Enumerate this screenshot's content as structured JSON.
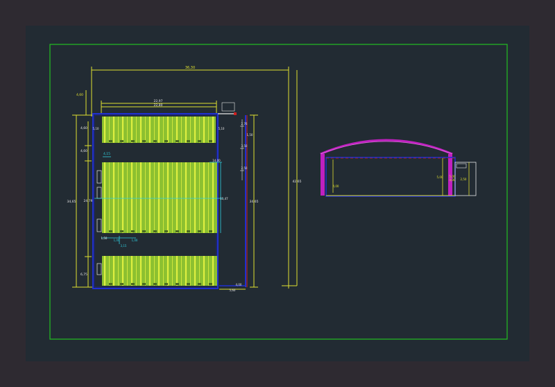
{
  "colors": {
    "window_bg": "#2e2a31",
    "model_bg": "#222b33",
    "frame": "#22c022",
    "dimension": "#e0e030",
    "wall": "#2030d0",
    "panel": "#8cc030",
    "panel_line": "#dff040",
    "cyan": "#30d0e0",
    "roof": "#c020c0",
    "white": "#e8e8e8"
  },
  "plan": {
    "top_overall": "36,30",
    "top_inner_1": "22,97",
    "top_inner_2": "22,80",
    "left_offset": "4,60",
    "right_overall": "42,65",
    "right_inner": "34,65",
    "left_overall": "34,65",
    "left_mid": "24,79",
    "left_top_1": "4,60",
    "left_top_2": "4,60",
    "left_bottom": "6,75",
    "section_top_left": "5,10",
    "section_top_right": "5,10",
    "cyan_1": "4,15",
    "cyan_2": "1,00",
    "cyan_3": "1,00",
    "cyan_4": "3,15",
    "cyan_5": "1,50",
    "mid_right_1": "14,00",
    "mid_right_2": "11,47",
    "bottom_small": "5,60",
    "bottom_small_2": "4,00",
    "stair_1": "2,76",
    "stair_2": "3,50",
    "stair_3": "2,50",
    "stair_4": "1,50"
  },
  "section": {
    "left_height": "4,00",
    "right_height_1": "5,00",
    "right_height_2": "4,00",
    "right_height_3": "2,50",
    "outer_height": "5,00"
  }
}
